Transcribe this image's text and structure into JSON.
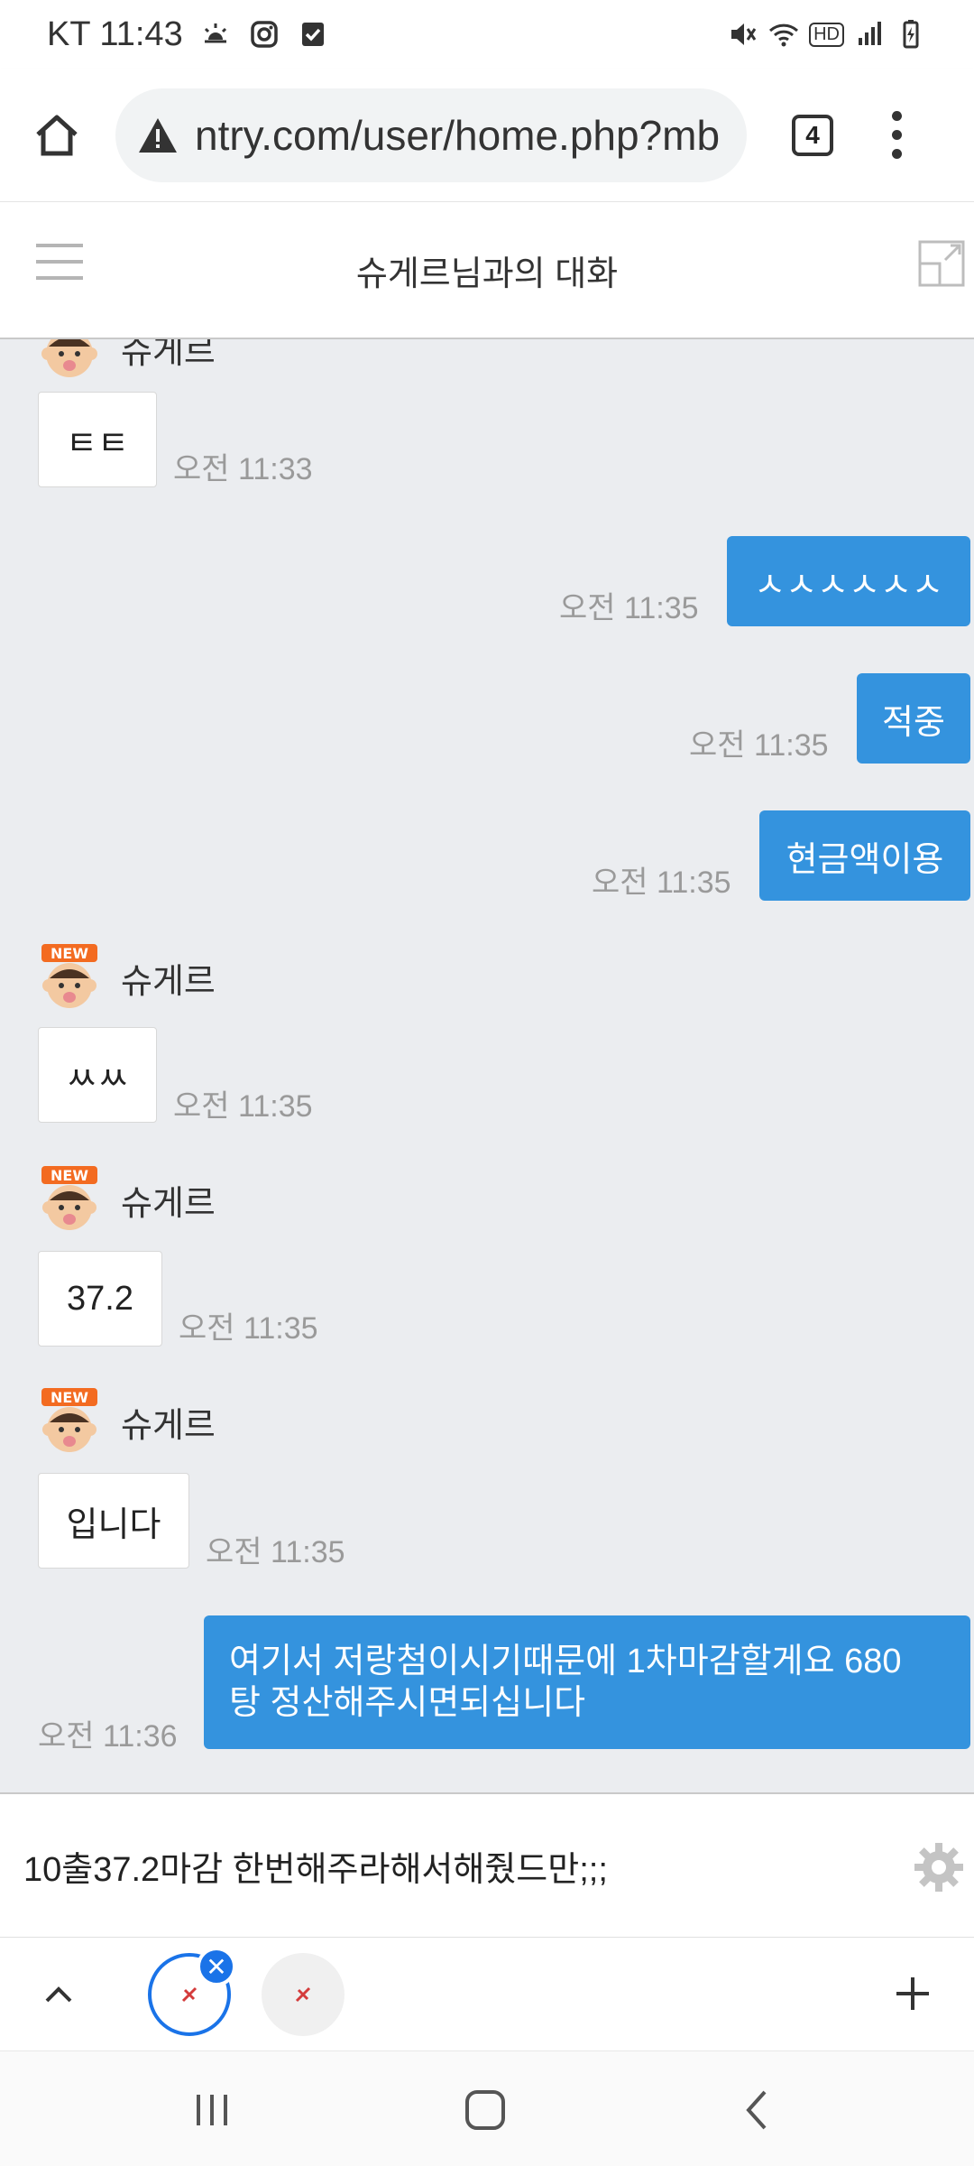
{
  "status_bar": {
    "carrier_time": "KT 11:43",
    "hd_badge": "HD"
  },
  "browser": {
    "url": "ntry.com/user/home.php?mb",
    "tab_count": "4"
  },
  "chat": {
    "title": "슈게르님과의 대화",
    "partner_name": "슈게르",
    "avatar_badge": "NEW",
    "messages": [
      {
        "direction": "in",
        "text": "ㅌㅌ",
        "time": "오전 11:33"
      },
      {
        "direction": "out",
        "text": "ㅅㅅㅅㅅㅅㅅ",
        "time": "오전 11:35"
      },
      {
        "direction": "out",
        "text": "적중",
        "time": "오전 11:35"
      },
      {
        "direction": "out",
        "text": "현금액이용",
        "time": "오전 11:35"
      },
      {
        "direction": "in",
        "text": "ㅆㅆ",
        "time": "오전 11:35"
      },
      {
        "direction": "in",
        "text": "37.2",
        "time": "오전 11:35"
      },
      {
        "direction": "in",
        "text": "입니다",
        "time": "오전 11:35"
      },
      {
        "direction": "out",
        "text_line1": "여기서 저랑첨이시기때문에 1차마감할게요 680",
        "text_line2": "탕 정산해주시면되십니다",
        "time": "오전 11:36"
      }
    ]
  },
  "input": {
    "value": "10출37.2마감 한번해주라해서해줬드만;;;"
  },
  "colors": {
    "accent_blue": "#3493de",
    "chat_bg": "#ebedf0"
  }
}
